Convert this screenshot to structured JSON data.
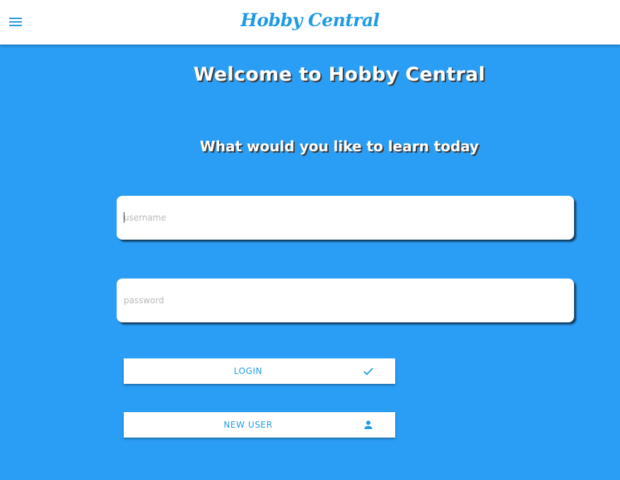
{
  "header": {
    "title": "Hobby Central",
    "menu_icon": "hamburger-menu-icon"
  },
  "hero": {
    "welcome": "Welcome to Hobby Central",
    "subtitle": "What would you like to learn today"
  },
  "form": {
    "username_placeholder": "username",
    "username_value": "",
    "password_placeholder": "password",
    "password_value": ""
  },
  "buttons": {
    "login_label": "LOGIN",
    "login_icon": "check-icon",
    "new_user_label": "NEW USER",
    "new_user_icon": "person-icon"
  },
  "colors": {
    "background": "#2a9df4",
    "accent": "#1e9be6",
    "surface": "#ffffff"
  }
}
